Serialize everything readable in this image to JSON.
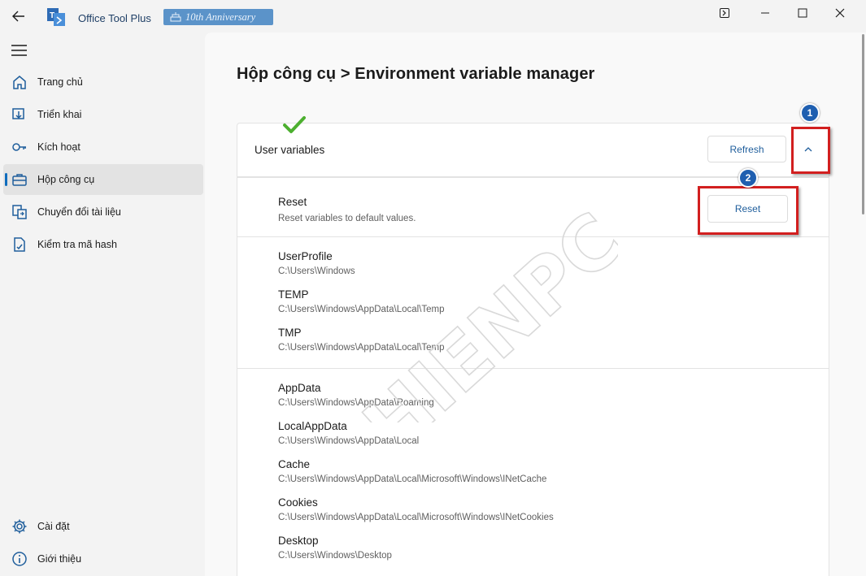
{
  "titlebar": {
    "app_title": "Office Tool Plus",
    "anniversary_badge": "10th Anniversary",
    "app_logo_text": "T"
  },
  "sidebar": {
    "items": [
      {
        "label": "Trang chủ",
        "icon": "home-icon"
      },
      {
        "label": "Triển khai",
        "icon": "deploy-icon"
      },
      {
        "label": "Kích hoạt",
        "icon": "key-icon"
      },
      {
        "label": "Hộp công cụ",
        "icon": "toolbox-icon",
        "active": true
      },
      {
        "label": "Chuyển đổi tài liệu",
        "icon": "convert-icon"
      },
      {
        "label": "Kiểm tra mã hash",
        "icon": "hash-check-icon"
      }
    ],
    "bottom_items": [
      {
        "label": "Cài đặt",
        "icon": "gear-icon"
      },
      {
        "label": "Giới thiệu",
        "icon": "info-icon"
      }
    ]
  },
  "main": {
    "title": "Hộp công cụ > Environment variable manager",
    "section_label": "User variables",
    "refresh_label": "Refresh",
    "reset": {
      "name": "Reset",
      "description": "Reset variables to default values.",
      "button_label": "Reset"
    },
    "group1": [
      {
        "name": "UserProfile",
        "value": "C:\\Users\\Windows"
      },
      {
        "name": "TEMP",
        "value": "C:\\Users\\Windows\\AppData\\Local\\Temp"
      },
      {
        "name": "TMP",
        "value": "C:\\Users\\Windows\\AppData\\Local\\Temp"
      }
    ],
    "group2": [
      {
        "name": "AppData",
        "value": "C:\\Users\\Windows\\AppData\\Roaming"
      },
      {
        "name": "LocalAppData",
        "value": "C:\\Users\\Windows\\AppData\\Local"
      },
      {
        "name": "Cache",
        "value": "C:\\Users\\Windows\\AppData\\Local\\Microsoft\\Windows\\INetCache"
      },
      {
        "name": "Cookies",
        "value": "C:\\Users\\Windows\\AppData\\Local\\Microsoft\\Windows\\INetCookies"
      },
      {
        "name": "Desktop",
        "value": "C:\\Users\\Windows\\Desktop"
      }
    ]
  },
  "annotations": {
    "step1": "1",
    "step2": "2",
    "watermark": "HIENPC",
    "highlight_color": "#d21f1f"
  },
  "colors": {
    "accent": "#0f6cbd",
    "badge": "#5b93c9"
  }
}
